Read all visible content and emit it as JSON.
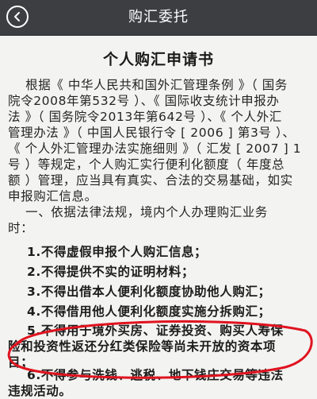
{
  "nav": {
    "title": "购汇委托",
    "back_icon": "chevron-left-icon"
  },
  "document": {
    "title": "个人购汇申请书",
    "intro_lines": [
      "    根据《 中华人民共和国外汇管理条例 》（ 国务",
      "院令2008年第532号 ）、《 国际收支统计申报办",
      "法 》（ 国务院令2013年第642号 ）、《 个人外汇",
      "管理办法 》（ 中国人民银行令 [ 2006 ] 第3号 ）、",
      "《 个人外汇管理办法实施细则 》（ 汇发 [ 2007 ] 1",
      "号 ）等规定，个人购汇实行便利化额度（ 年度总",
      "额 ）管理，应当具有真实、合法的交易基础，如实",
      "申报购汇信息。"
    ],
    "section_heading_lines": [
      "    一、依据法律法规，境内个人办理购汇业务",
      "时："
    ],
    "items": [
      [
        "    1.不得虚假申报个人购汇信息；"
      ],
      [
        "    2.不得提供不实的证明材料；"
      ],
      [
        "    3.不得出借本人便利化额度协助他人购汇；"
      ],
      [
        "    4.不得借用他人便利化额度实施分拆购汇；"
      ],
      [
        "    5.不得用于境外买房、证券投资、购买人寿保",
        "险和投资性返还分红类保险等尚未开放的资本项",
        "目；"
      ],
      [
        "    6.不得参与洗钱、逃税、地下钱庄交易等违法",
        "违规活动。"
      ]
    ]
  },
  "highlight": {
    "color": "#e0131f",
    "shape": "ellipse"
  }
}
